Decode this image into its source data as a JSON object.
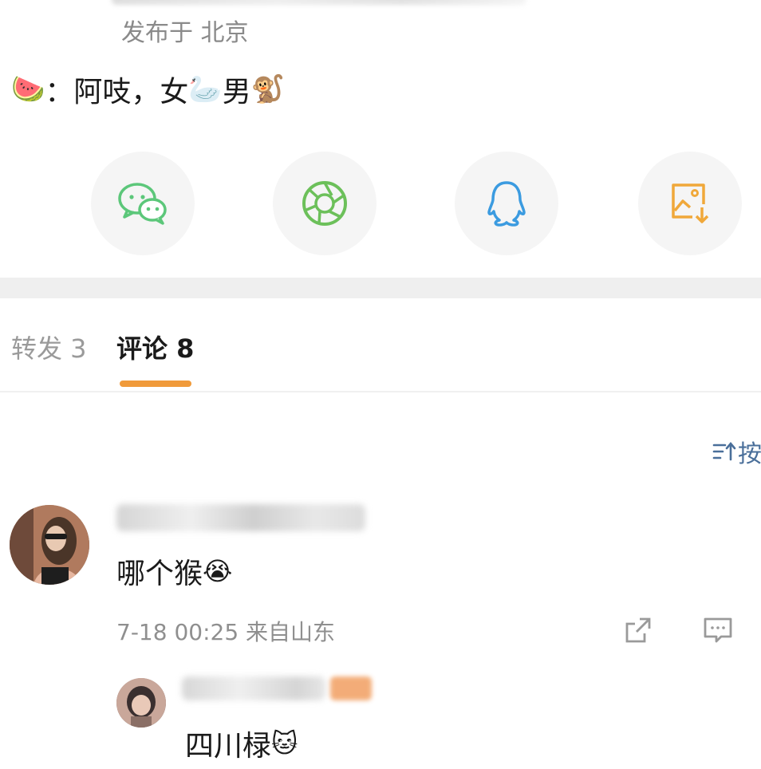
{
  "post": {
    "location": "发布于 北京",
    "content_prefix_emoji": "🍉",
    "content_text_1": "：阿吱，女",
    "content_emoji_1": "🦢",
    "content_text_2": "男",
    "content_emoji_2": "🐒"
  },
  "share": [
    {
      "name": "wechat-icon",
      "color": "#5cc77a"
    },
    {
      "name": "moments-icon",
      "color": "#6cc05a"
    },
    {
      "name": "qq-icon",
      "color": "#3b9be0"
    },
    {
      "name": "save-image-icon",
      "color": "#f0a83a"
    }
  ],
  "tabs": {
    "forward": "转发 3",
    "comment": "评论 8",
    "active_color": "#f09a3a"
  },
  "sort": {
    "label": "按"
  },
  "comment": {
    "text": "哪个猴",
    "emoji": "😭",
    "meta": "7-18 00:25 来自山东"
  },
  "reply": {
    "text": "四川椂",
    "emoji": "🐱"
  }
}
